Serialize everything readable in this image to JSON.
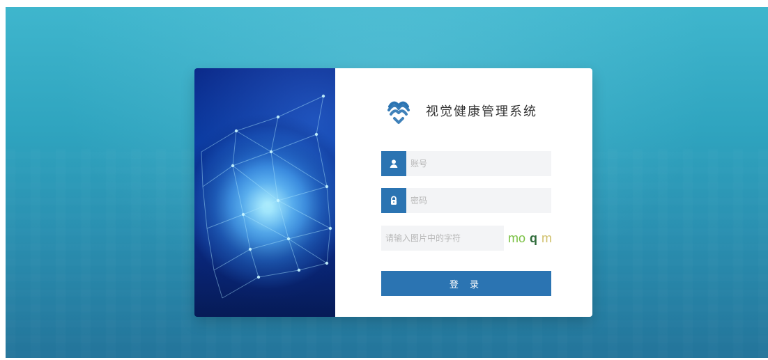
{
  "app": {
    "title": "视觉健康管理系统"
  },
  "login": {
    "username_placeholder": "账号",
    "password_placeholder": "密码",
    "captcha_placeholder": "请输入图片中的字符",
    "captcha_text_parts": [
      "mo",
      "q",
      "m"
    ],
    "submit_label": "登 录"
  },
  "icons": {
    "username": "user-icon",
    "password": "lock-icon",
    "brand": "heart-logo-icon"
  },
  "colors": {
    "primary": "#2b74b2",
    "field_bg": "#f3f4f6",
    "bg_teal": "#2fa4bf",
    "title_text": "#333333",
    "captcha_1": "#7ac143",
    "captcha_2": "#2f6b3a",
    "captcha_3": "#d0c06a"
  }
}
